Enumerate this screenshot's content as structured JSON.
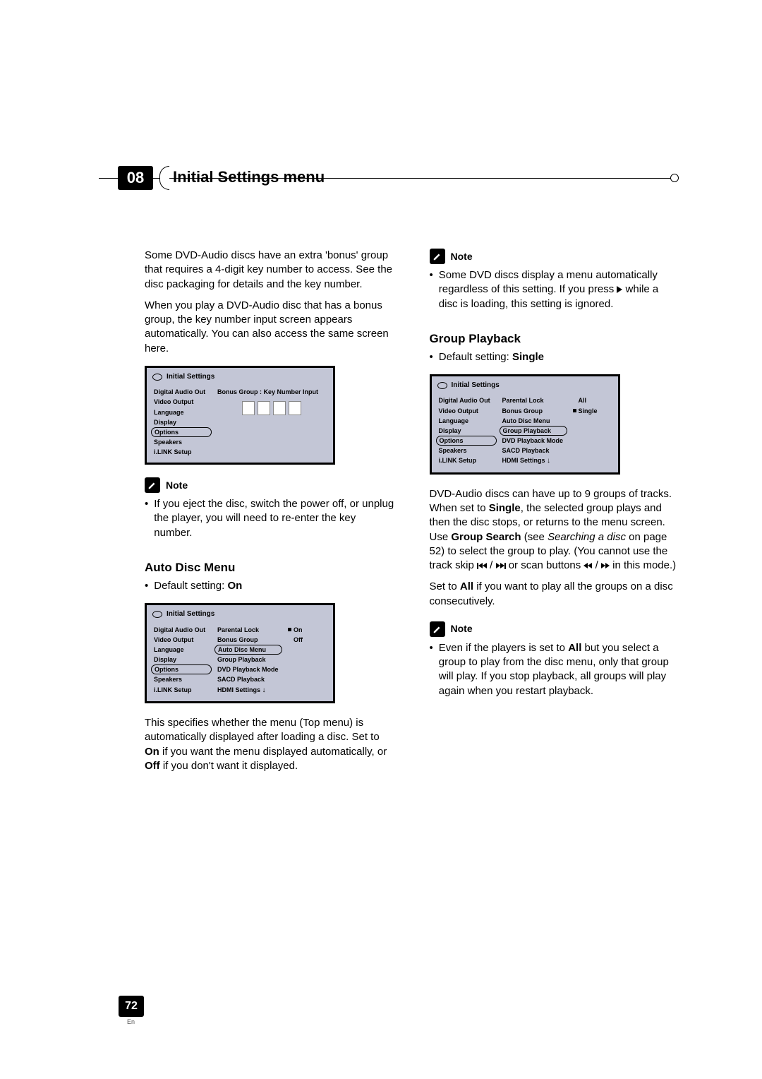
{
  "chapter": {
    "number": "08",
    "title": "Initial Settings menu"
  },
  "page": {
    "number": "72",
    "lang": "En"
  },
  "left": {
    "p1": "Some DVD-Audio discs have an extra 'bonus' group that requires a 4-digit key number to access. See the disc packaging for details and the key number.",
    "p2": "When you play a DVD-Audio disc that has a bonus group, the key number input screen appears automatically. You can also access the same screen here.",
    "note_label": "Note",
    "note1": "If you eject the disc, switch the power off, or unplug the player, you will need to re-enter the key number.",
    "sec1_head": "Auto Disc Menu",
    "sec1_default_prefix": "Default setting: ",
    "sec1_default_value": "On",
    "sec1_body_a": "This specifies whether the menu (Top menu) is automatically displayed after loading a disc. Set to ",
    "sec1_body_on": "On",
    "sec1_body_b": " if you want the menu displayed automatically, or ",
    "sec1_body_off": "Off",
    "sec1_body_c": " if you don't want it displayed."
  },
  "right": {
    "note_label": "Note",
    "note1_a": "Some DVD discs display a menu automatically regardless of this setting. If you press ",
    "note1_b": " while a disc is loading, this setting is ignored.",
    "sec_head": "Group Playback",
    "default_prefix": "Default setting: ",
    "default_value": "Single",
    "body_a": "DVD-Audio discs can have up to 9 groups of tracks. When set to ",
    "body_single": "Single",
    "body_b": ", the selected group plays and then the disc stops, or returns to the menu screen. Use ",
    "body_groupsearch": "Group Search",
    "body_c": " (see ",
    "body_ref_italic": "Searching a disc",
    "body_d": " on page 52) to select the group to play. (You cannot use the track skip ",
    "body_e": " or scan buttons ",
    "body_f": " in this mode.)",
    "body2_a": "Set to ",
    "body2_all": "All",
    "body2_b": " if you want to play all the groups on a disc consecutively.",
    "note2_label": "Note",
    "note2_a": "Even if the players is set to ",
    "note2_all": "All",
    "note2_b": " but you select a group to play from the disc menu, only that group will play. If you stop playback, all groups will play again when you restart playback."
  },
  "ui": {
    "title": "Initial Settings",
    "col1": [
      "Digital Audio Out",
      "Video Output",
      "Language",
      "Display",
      "Options",
      "Speakers",
      "i.LINK Setup"
    ],
    "box1_right_label": "Bonus Group : Key Number Input",
    "box2_col2": [
      "Parental Lock",
      "Bonus Group",
      "Auto Disc Menu",
      "Group Playback",
      "DVD Playback Mode",
      "SACD Playback",
      "HDMI Settings"
    ],
    "box2_col3": [
      "On",
      "Off"
    ],
    "box3_col2": [
      "Parental Lock",
      "Bonus Group",
      "Auto Disc Menu",
      "Group Playback",
      "DVD Playback Mode",
      "SACD Playback",
      "HDMI Settings"
    ],
    "box3_col3": [
      "All",
      "Single"
    ]
  }
}
